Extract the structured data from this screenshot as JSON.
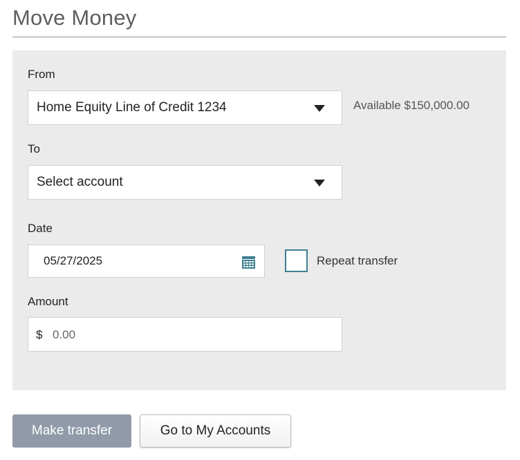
{
  "page": {
    "title": "Move Money"
  },
  "form": {
    "from": {
      "label": "From",
      "selected": "Home Equity Line of Credit 1234",
      "available": "Available $150,000.00"
    },
    "to": {
      "label": "To",
      "selected": "Select account"
    },
    "date": {
      "label": "Date",
      "value": "05/27/2025"
    },
    "repeat": {
      "label": "Repeat transfer",
      "checked": false
    },
    "amount": {
      "label": "Amount",
      "currency_symbol": "$",
      "placeholder": "0.00"
    }
  },
  "actions": {
    "make_transfer": "Make transfer",
    "go_to_accounts": "Go to My Accounts"
  },
  "colors": {
    "panel_bg": "#ebebeb",
    "primary_button": "#909aa9",
    "checkbox_border": "#3d7f8f",
    "calendar_icon": "#3d7f8f"
  },
  "icons": {
    "from_caret": "chevron-down-icon",
    "to_caret": "chevron-down-icon",
    "date_picker": "calendar-icon"
  }
}
